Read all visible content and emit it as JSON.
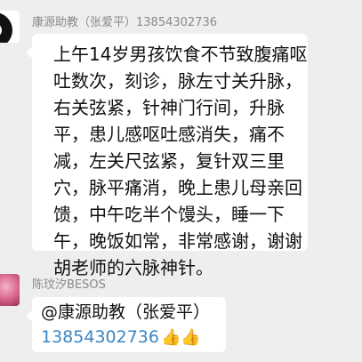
{
  "messages": [
    {
      "sender": "康源助教（张爱平）13854302736",
      "text": "上午14岁男孩饮食不节致腹痛呕吐数次，刻诊，脉左寸关升脉，右关弦紧，针神门行间，升脉平，患儿感呕吐感消失，痛不减，左关尺弦紧，复针双三里穴，脉平痛消，晚上患儿母亲回馈，中午吃半个馒头，睡一下午，晚饭如常，非常感谢，谢谢胡老师的六脉神针。"
    },
    {
      "sender": "陈玟汐BESOS",
      "mention": "@康源助教（张爱平）",
      "phone": "13854302736",
      "emoji": "👍👍"
    }
  ],
  "colors": {
    "background": "#eeeeee",
    "bubble": "#ffffff",
    "sender_name": "#8a8a8a",
    "phone_link": "#3b86c4"
  }
}
